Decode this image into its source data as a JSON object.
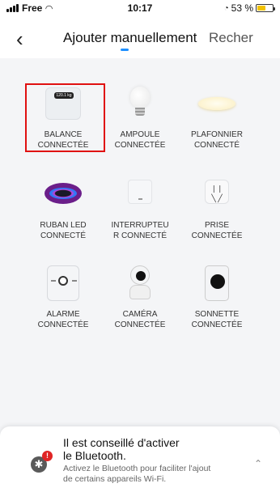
{
  "status_bar": {
    "carrier": "Free",
    "time": "10:17",
    "battery_percent_label": "53 %",
    "battery_level": 0.53
  },
  "header": {
    "back_icon": "chevron-left-icon",
    "tab_active": "Ajouter manuellement",
    "tab_inactive": "Recher",
    "accent_color": "#1e90ff"
  },
  "devices": [
    {
      "label": "BALANCE\nCONNECTÉE",
      "icon": "scale-icon",
      "screen_text": "120.1 kg"
    },
    {
      "label": "AMPOULE\nCONNECTÉE",
      "icon": "bulb-icon"
    },
    {
      "label": "PLAFONNIER\nCONNECTÉ",
      "icon": "ceiling-light-icon"
    },
    {
      "label": "RUBAN LED\nCONNECTÉ",
      "icon": "led-strip-icon"
    },
    {
      "label": "INTERRUPTEU\nR CONNECTÉ",
      "icon": "switch-icon"
    },
    {
      "label": "PRISE\nCONNECTÉE",
      "icon": "plug-icon"
    },
    {
      "label": "ALARME\nCONNECTÉE",
      "icon": "alarm-icon"
    },
    {
      "label": "CAMÉRA\nCONNECTÉE",
      "icon": "camera-icon"
    },
    {
      "label": "SONNETTE\nCONNECTÉE",
      "icon": "doorbell-icon"
    }
  ],
  "selected_color": "#e01010",
  "bluetooth_banner": {
    "title": "Il est conseillé d'activer\nle Bluetooth.",
    "text": "Activez le Bluetooth pour faciliter l'ajout\nde certains appareils Wi-Fi.",
    "icon": "bluetooth-icon",
    "alert_glyph": "!"
  }
}
